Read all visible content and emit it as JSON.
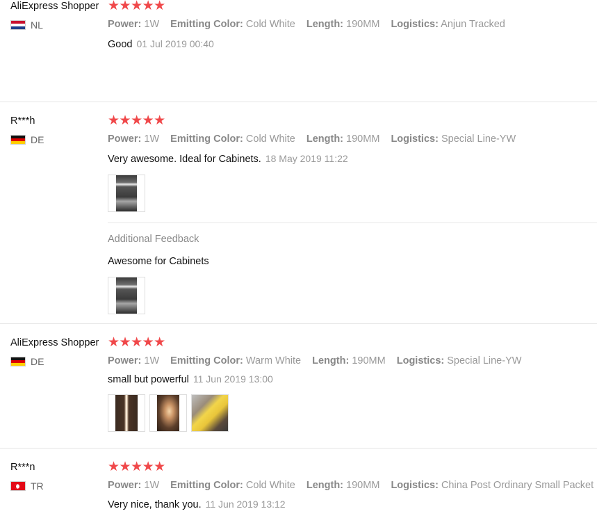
{
  "reviews": [
    {
      "user": "AliExpress Shopper",
      "country": "NL",
      "stars": "★★★★★",
      "attributes": [
        {
          "label": "Power:",
          "value": "1W"
        },
        {
          "label": "Emitting Color:",
          "value": "Cold White"
        },
        {
          "label": "Length:",
          "value": "190MM"
        },
        {
          "label": "Logistics:",
          "value": "Anjun Tracked"
        }
      ],
      "comment": "Good",
      "date": "01 Jul 2019 00:40"
    },
    {
      "user": "R***h",
      "country": "DE",
      "stars": "★★★★★",
      "attributes": [
        {
          "label": "Power:",
          "value": "1W"
        },
        {
          "label": "Emitting Color:",
          "value": "Cold White"
        },
        {
          "label": "Length:",
          "value": "190MM"
        },
        {
          "label": "Logistics:",
          "value": "Special Line-YW"
        }
      ],
      "comment": "Very awesome. Ideal for Cabinets.",
      "date": "18 May 2019 11:22",
      "additional_label": "Additional Feedback",
      "additional_text": "Awesome for Cabinets"
    },
    {
      "user": "AliExpress Shopper",
      "country": "DE",
      "stars": "★★★★★",
      "attributes": [
        {
          "label": "Power:",
          "value": "1W"
        },
        {
          "label": "Emitting Color:",
          "value": "Warm White"
        },
        {
          "label": "Length:",
          "value": "190MM"
        },
        {
          "label": "Logistics:",
          "value": "Special Line-YW"
        }
      ],
      "comment": "small but powerful",
      "date": "11 Jun 2019 13:00"
    },
    {
      "user": "R***n",
      "country": "TR",
      "stars": "★★★★★",
      "attributes": [
        {
          "label": "Power:",
          "value": "1W"
        },
        {
          "label": "Emitting Color:",
          "value": "Cold White"
        },
        {
          "label": "Length:",
          "value": "190MM"
        },
        {
          "label": "Logistics:",
          "value": "China Post Ordinary Small Packet Plus"
        }
      ],
      "comment": "Very nice, thank you.",
      "date": "11 Jun 2019 13:12"
    }
  ],
  "rating": 5,
  "colors": {
    "star": "#f0484a",
    "muted": "#999999",
    "divider": "#e6e6e6"
  }
}
